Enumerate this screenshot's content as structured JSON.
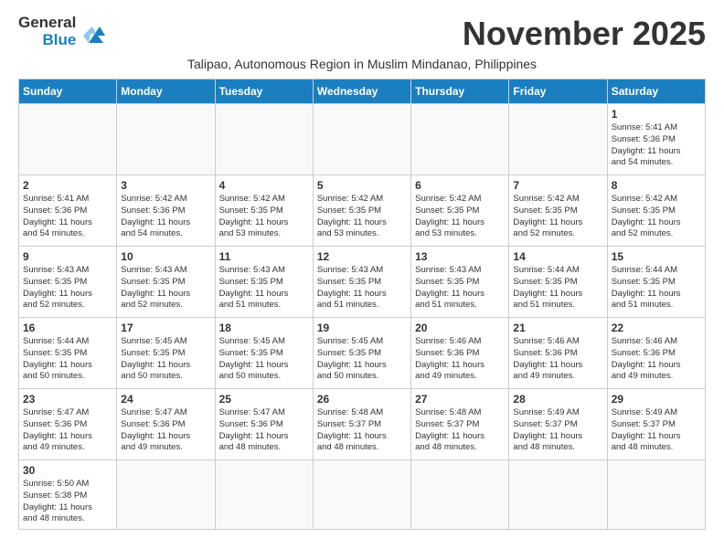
{
  "logo": {
    "line1": "General",
    "line2": "Blue"
  },
  "title": "November 2025",
  "subtitle": "Talipao, Autonomous Region in Muslim Mindanao, Philippines",
  "days_of_week": [
    "Sunday",
    "Monday",
    "Tuesday",
    "Wednesday",
    "Thursday",
    "Friday",
    "Saturday"
  ],
  "weeks": [
    [
      {
        "num": "",
        "info": ""
      },
      {
        "num": "",
        "info": ""
      },
      {
        "num": "",
        "info": ""
      },
      {
        "num": "",
        "info": ""
      },
      {
        "num": "",
        "info": ""
      },
      {
        "num": "",
        "info": ""
      },
      {
        "num": "1",
        "info": "Sunrise: 5:41 AM\nSunset: 5:36 PM\nDaylight: 11 hours\nand 54 minutes."
      }
    ],
    [
      {
        "num": "2",
        "info": "Sunrise: 5:41 AM\nSunset: 5:36 PM\nDaylight: 11 hours\nand 54 minutes."
      },
      {
        "num": "3",
        "info": "Sunrise: 5:42 AM\nSunset: 5:36 PM\nDaylight: 11 hours\nand 54 minutes."
      },
      {
        "num": "4",
        "info": "Sunrise: 5:42 AM\nSunset: 5:35 PM\nDaylight: 11 hours\nand 53 minutes."
      },
      {
        "num": "5",
        "info": "Sunrise: 5:42 AM\nSunset: 5:35 PM\nDaylight: 11 hours\nand 53 minutes."
      },
      {
        "num": "6",
        "info": "Sunrise: 5:42 AM\nSunset: 5:35 PM\nDaylight: 11 hours\nand 53 minutes."
      },
      {
        "num": "7",
        "info": "Sunrise: 5:42 AM\nSunset: 5:35 PM\nDaylight: 11 hours\nand 52 minutes."
      },
      {
        "num": "8",
        "info": "Sunrise: 5:42 AM\nSunset: 5:35 PM\nDaylight: 11 hours\nand 52 minutes."
      }
    ],
    [
      {
        "num": "9",
        "info": "Sunrise: 5:43 AM\nSunset: 5:35 PM\nDaylight: 11 hours\nand 52 minutes."
      },
      {
        "num": "10",
        "info": "Sunrise: 5:43 AM\nSunset: 5:35 PM\nDaylight: 11 hours\nand 52 minutes."
      },
      {
        "num": "11",
        "info": "Sunrise: 5:43 AM\nSunset: 5:35 PM\nDaylight: 11 hours\nand 51 minutes."
      },
      {
        "num": "12",
        "info": "Sunrise: 5:43 AM\nSunset: 5:35 PM\nDaylight: 11 hours\nand 51 minutes."
      },
      {
        "num": "13",
        "info": "Sunrise: 5:43 AM\nSunset: 5:35 PM\nDaylight: 11 hours\nand 51 minutes."
      },
      {
        "num": "14",
        "info": "Sunrise: 5:44 AM\nSunset: 5:35 PM\nDaylight: 11 hours\nand 51 minutes."
      },
      {
        "num": "15",
        "info": "Sunrise: 5:44 AM\nSunset: 5:35 PM\nDaylight: 11 hours\nand 51 minutes."
      }
    ],
    [
      {
        "num": "16",
        "info": "Sunrise: 5:44 AM\nSunset: 5:35 PM\nDaylight: 11 hours\nand 50 minutes."
      },
      {
        "num": "17",
        "info": "Sunrise: 5:45 AM\nSunset: 5:35 PM\nDaylight: 11 hours\nand 50 minutes."
      },
      {
        "num": "18",
        "info": "Sunrise: 5:45 AM\nSunset: 5:35 PM\nDaylight: 11 hours\nand 50 minutes."
      },
      {
        "num": "19",
        "info": "Sunrise: 5:45 AM\nSunset: 5:35 PM\nDaylight: 11 hours\nand 50 minutes."
      },
      {
        "num": "20",
        "info": "Sunrise: 5:46 AM\nSunset: 5:36 PM\nDaylight: 11 hours\nand 49 minutes."
      },
      {
        "num": "21",
        "info": "Sunrise: 5:46 AM\nSunset: 5:36 PM\nDaylight: 11 hours\nand 49 minutes."
      },
      {
        "num": "22",
        "info": "Sunrise: 5:46 AM\nSunset: 5:36 PM\nDaylight: 11 hours\nand 49 minutes."
      }
    ],
    [
      {
        "num": "23",
        "info": "Sunrise: 5:47 AM\nSunset: 5:36 PM\nDaylight: 11 hours\nand 49 minutes."
      },
      {
        "num": "24",
        "info": "Sunrise: 5:47 AM\nSunset: 5:36 PM\nDaylight: 11 hours\nand 49 minutes."
      },
      {
        "num": "25",
        "info": "Sunrise: 5:47 AM\nSunset: 5:36 PM\nDaylight: 11 hours\nand 48 minutes."
      },
      {
        "num": "26",
        "info": "Sunrise: 5:48 AM\nSunset: 5:37 PM\nDaylight: 11 hours\nand 48 minutes."
      },
      {
        "num": "27",
        "info": "Sunrise: 5:48 AM\nSunset: 5:37 PM\nDaylight: 11 hours\nand 48 minutes."
      },
      {
        "num": "28",
        "info": "Sunrise: 5:49 AM\nSunset: 5:37 PM\nDaylight: 11 hours\nand 48 minutes."
      },
      {
        "num": "29",
        "info": "Sunrise: 5:49 AM\nSunset: 5:37 PM\nDaylight: 11 hours\nand 48 minutes."
      }
    ],
    [
      {
        "num": "30",
        "info": "Sunrise: 5:50 AM\nSunset: 5:38 PM\nDaylight: 11 hours\nand 48 minutes."
      },
      {
        "num": "",
        "info": ""
      },
      {
        "num": "",
        "info": ""
      },
      {
        "num": "",
        "info": ""
      },
      {
        "num": "",
        "info": ""
      },
      {
        "num": "",
        "info": ""
      },
      {
        "num": "",
        "info": ""
      }
    ]
  ]
}
